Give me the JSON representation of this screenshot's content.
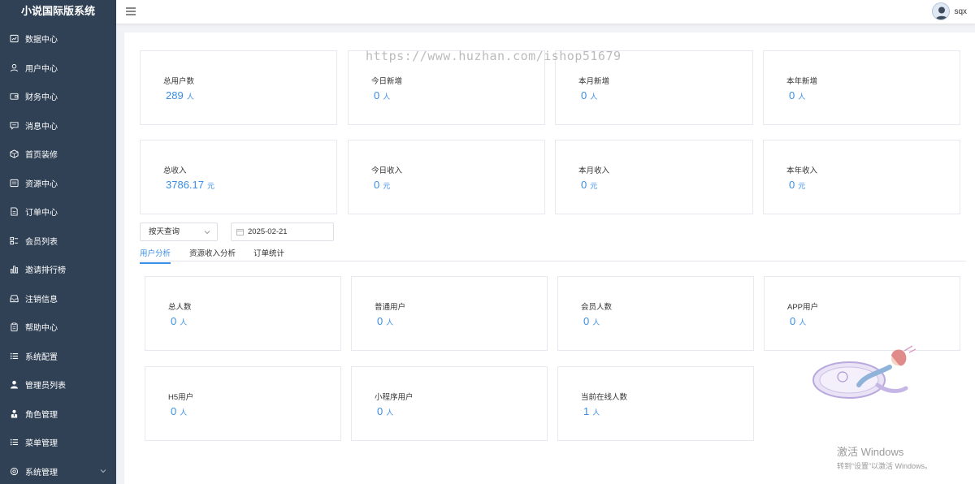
{
  "app": {
    "title": "小说国际版系统"
  },
  "sidebar": {
    "items": [
      {
        "label": "数据中心",
        "icon": "dashboard-icon"
      },
      {
        "label": "用户中心",
        "icon": "user-icon"
      },
      {
        "label": "财务中心",
        "icon": "wallet-icon"
      },
      {
        "label": "消息中心",
        "icon": "message-icon"
      },
      {
        "label": "首页装修",
        "icon": "box-icon"
      },
      {
        "label": "资源中心",
        "icon": "resource-icon"
      },
      {
        "label": "订单中心",
        "icon": "order-icon"
      },
      {
        "label": "会员列表",
        "icon": "grid-list-icon"
      },
      {
        "label": "邀请排行榜",
        "icon": "bar-chart-icon"
      },
      {
        "label": "注销信息",
        "icon": "inbox-icon"
      },
      {
        "label": "帮助中心",
        "icon": "clipboard-icon"
      },
      {
        "label": "系统配置",
        "icon": "list-icon"
      },
      {
        "label": "管理员列表",
        "icon": "person-solid-icon"
      },
      {
        "label": "角色管理",
        "icon": "role-icon"
      },
      {
        "label": "菜单管理",
        "icon": "menu-list-icon"
      },
      {
        "label": "系统管理",
        "icon": "gear-icon"
      }
    ]
  },
  "header": {
    "username": "sqx"
  },
  "overview_users": [
    {
      "label": "总用户数",
      "value": "289",
      "unit": "人"
    },
    {
      "label": "今日新增",
      "value": "0",
      "unit": "人"
    },
    {
      "label": "本月新增",
      "value": "0",
      "unit": "人"
    },
    {
      "label": "本年新增",
      "value": "0",
      "unit": "人"
    }
  ],
  "overview_income": [
    {
      "label": "总收入",
      "value": "3786.17",
      "unit": "元"
    },
    {
      "label": "今日收入",
      "value": "0",
      "unit": "元"
    },
    {
      "label": "本月收入",
      "value": "0",
      "unit": "元"
    },
    {
      "label": "本年收入",
      "value": "0",
      "unit": "元"
    }
  ],
  "filters": {
    "query_mode": "按天查询",
    "date": "2025-02-21"
  },
  "tabs": [
    {
      "label": "用户分析",
      "active": true
    },
    {
      "label": "资源收入分析",
      "active": false
    },
    {
      "label": "订单统计",
      "active": false
    }
  ],
  "analysis_row1": [
    {
      "label": "总人数",
      "value": "0",
      "unit": "人"
    },
    {
      "label": "普通用户",
      "value": "0",
      "unit": "人"
    },
    {
      "label": "会员人数",
      "value": "0",
      "unit": "人"
    },
    {
      "label": "APP用户",
      "value": "0",
      "unit": "人"
    }
  ],
  "analysis_row2": [
    {
      "label": "H5用户",
      "value": "0",
      "unit": "人"
    },
    {
      "label": "小程序用户",
      "value": "0",
      "unit": "人"
    },
    {
      "label": "当前在线人数",
      "value": "1",
      "unit": "人"
    }
  ],
  "watermark": "https://www.huzhan.com/ishop51679",
  "windows_activation": {
    "line1": "激活 Windows",
    "line2": "转到“设置”以激活 Windows。"
  },
  "colors": {
    "sidebar": "#304156",
    "accent": "#3a8ee6"
  }
}
